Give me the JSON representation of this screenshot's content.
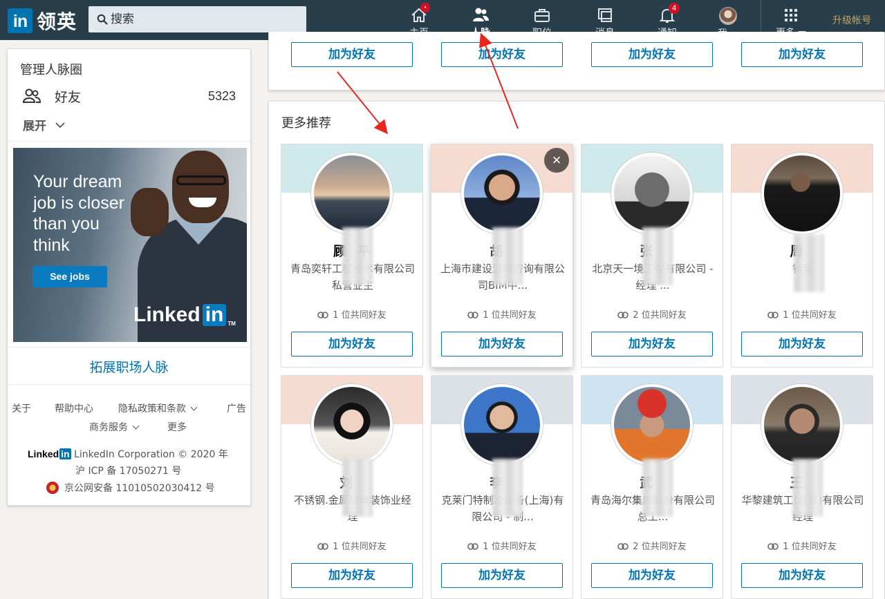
{
  "app": {
    "logo_mark": "in",
    "logo_text": "领英"
  },
  "search": {
    "placeholder": "搜索"
  },
  "nav": {
    "home": {
      "label": "主页",
      "badge": "•"
    },
    "network": {
      "label": "人脉"
    },
    "jobs": {
      "label": "职位"
    },
    "messaging": {
      "label": "消息"
    },
    "notifications": {
      "label": "通知",
      "badge": "4"
    },
    "me": {
      "label": "我"
    },
    "more": {
      "label": "更多"
    },
    "upgrade": "升级帐号"
  },
  "sidebar": {
    "title": "管理人脉圈",
    "friends_label": "好友",
    "friends_count": "5323",
    "expand_label": "展开",
    "grow_link": "拓展职场人脉"
  },
  "ad": {
    "headline": "Your dream\njob is closer\nthan you\nthink",
    "button": "See jobs",
    "brand": "Linked",
    "brand_in": "in",
    "tm": "TM"
  },
  "footer": {
    "about": "关于",
    "help": "帮助中心",
    "privacy": "隐私政策和条款",
    "ads": "广告",
    "business": "商务服务",
    "more": "更多",
    "brand": "Linked",
    "brand_in": "in",
    "copyright": "LinkedIn Corporation © 2020 年",
    "icp": "沪 ICP 备 17050271 号",
    "police": "京公网安备 11010502030412 号"
  },
  "top_row_button": "加为好友",
  "more_section": {
    "title": "更多推荐"
  },
  "cards": [
    {
      "name": "顾",
      "name_tail": "平",
      "desc": "青岛奕轩工程技术有限公司私营业主",
      "mutual": "1 位共同好友",
      "button": "加为好友",
      "banner": "#cfe9ec"
    },
    {
      "name": "胡",
      "name_tail": "",
      "desc": "上海市建设监理咨询有限公司BIM中...",
      "mutual": "1 位共同好友",
      "button": "加为好友",
      "banner": "#f6dcd0"
    },
    {
      "name": "张",
      "name_tail": "",
      "desc": "北京天一境工程有限公司 - 经理 ...",
      "mutual": "2 位共同好友",
      "button": "加为好友",
      "banner": "#cfe9ec"
    },
    {
      "name": "周",
      "name_tail": "",
      "desc": "销售",
      "mutual": "1 位共同好友",
      "button": "加为好友",
      "banner": "#f6dcd0"
    },
    {
      "name": "刘",
      "name_tail": "",
      "desc": "不锈钢.金属玻璃装饰业经理",
      "mutual": "1 位共同好友",
      "button": "加为好友",
      "banner": "#f6dcd0"
    },
    {
      "name": "李",
      "name_tail": "",
      "desc": "克莱门特制冷设备(上海)有限公司 - 制...",
      "mutual": "1 位共同好友",
      "button": "加为好友",
      "banner": "#dce1e7"
    },
    {
      "name": "武",
      "name_tail": "",
      "desc": "青岛海尔集成股份有限公司总工...",
      "mutual": "2 位共同好友",
      "button": "加为好友",
      "banner": "#cfe4f2"
    },
    {
      "name": "王",
      "name_tail": "",
      "desc": "华黎建筑工(北京)有限公司经理",
      "mutual": "1 位共同好友",
      "button": "加为好友",
      "banner": "#dce1e7"
    }
  ],
  "colors": {
    "nav_bg": "#283e4a",
    "brand_blue": "#0073b1",
    "badge_red": "#d11124",
    "upgrade_gold": "#c7a55c",
    "annotation_red": "#e8261c"
  }
}
